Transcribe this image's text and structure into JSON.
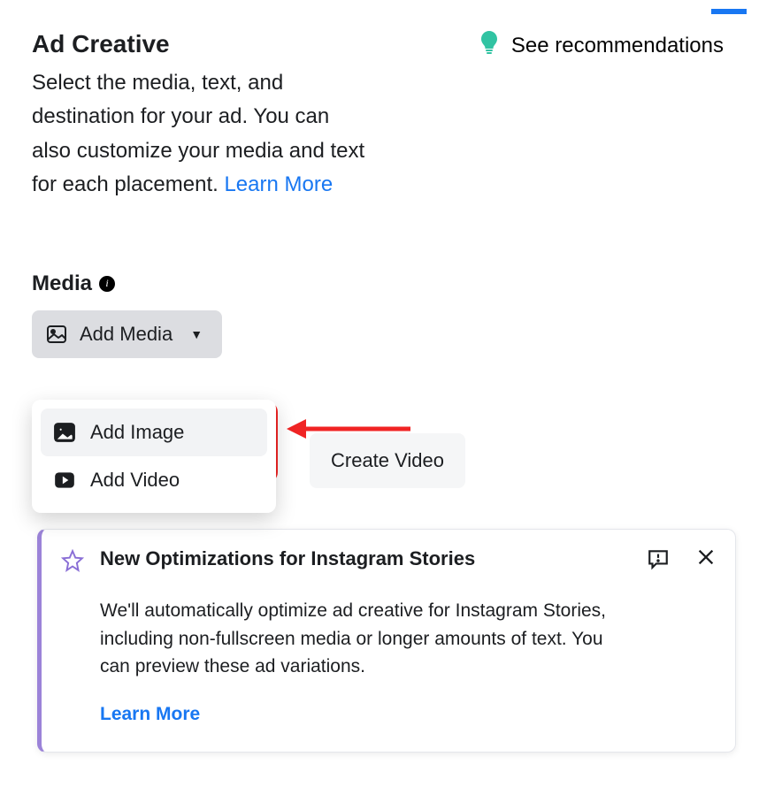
{
  "header": {
    "title": "Ad Creative",
    "recommendations": "See recommendations",
    "description_a": "Select the media, text, and destination for your ad. You can also customize your media and text for each placement. ",
    "learn_more": "Learn More"
  },
  "media": {
    "label": "Media",
    "add_media": "Add Media",
    "create_video": "Create Video",
    "menu": {
      "add_image": "Add Image",
      "add_video": "Add Video"
    }
  },
  "card": {
    "title": "New Optimizations for Instagram Stories",
    "body": "We'll automatically optimize ad creative for Instagram Stories, including non-fullscreen media or longer amounts of text. You can preview these ad variations.",
    "learn_more": "Learn More"
  },
  "icons": {
    "bulb": "bulb-icon",
    "info": "info-icon",
    "image": "image-icon",
    "video": "video-icon",
    "star": "star-icon",
    "feedback": "feedback-icon",
    "close": "close-icon",
    "caret": "caret-down-icon"
  }
}
